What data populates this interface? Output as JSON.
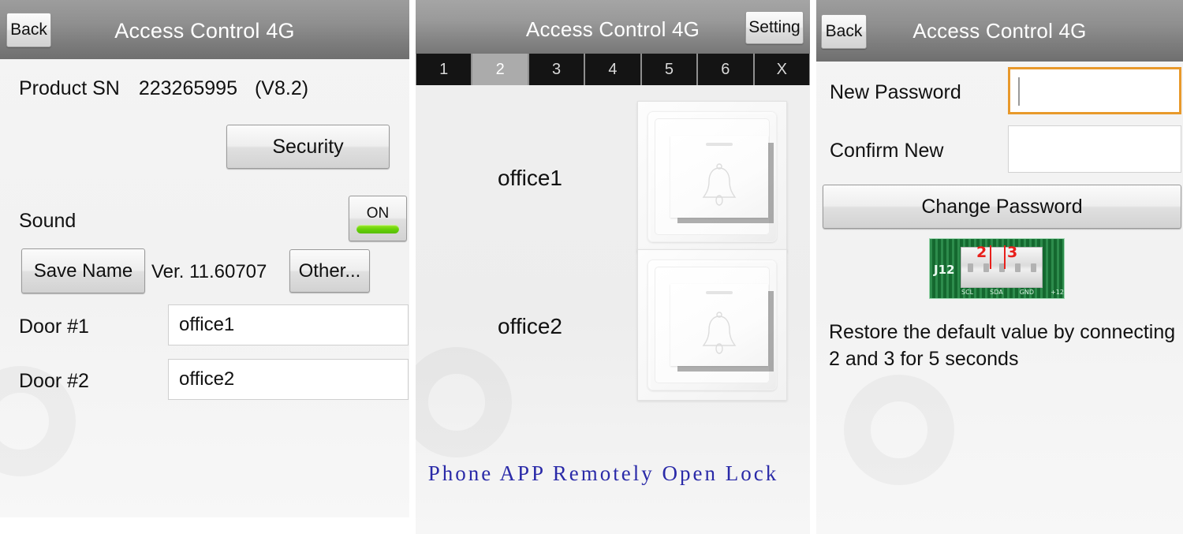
{
  "app": {
    "title": "Access Control 4G"
  },
  "panel1": {
    "header": {
      "title": "Access Control 4G",
      "back_label": "Back",
      "back_icon": "back-arrow-icon"
    },
    "product_sn": {
      "label": "Product SN",
      "value": "223265995",
      "version": "(V8.2)"
    },
    "security_button": "Security",
    "sound": {
      "label": "Sound",
      "toggle_state": "ON",
      "toggle_color": "#64cf08"
    },
    "save_name_button": "Save Name",
    "version_label": "Ver. 11.60707",
    "other_button": "Other...",
    "doors": [
      {
        "label": "Door #1",
        "value": "office1",
        "placeholder": "Door name"
      },
      {
        "label": "Door #2",
        "value": "office2",
        "placeholder": "Door name"
      }
    ]
  },
  "panel2": {
    "header": {
      "title": "Access Control 4G",
      "setting_label": "Setting"
    },
    "tabs": [
      {
        "label": "1",
        "selected": false
      },
      {
        "label": "2",
        "selected": true
      },
      {
        "label": "3",
        "selected": false
      },
      {
        "label": "4",
        "selected": false
      },
      {
        "label": "5",
        "selected": false
      },
      {
        "label": "6",
        "selected": false
      },
      {
        "label": "X",
        "selected": false
      }
    ],
    "switches": [
      {
        "name": "office1",
        "icon": "doorbell-switch-icon"
      },
      {
        "name": "office2",
        "icon": "doorbell-switch-icon"
      }
    ],
    "caption": "Phone APP Remotely Open Lock",
    "caption_color": "#2a2aa8"
  },
  "panel3": {
    "header": {
      "title": "Access Control 4G",
      "back_label": "Back"
    },
    "new_password": {
      "label": "New Password",
      "value": "",
      "placeholder": "",
      "focused": true
    },
    "confirm_password": {
      "label": "Confirm New",
      "value": "",
      "placeholder": "",
      "focused": false
    },
    "change_password_button": "Change Password",
    "focus_color": "#e8992b",
    "pcb": {
      "connector_label": "J12",
      "pin_markers": [
        "2",
        "3"
      ],
      "silkscreen": [
        "SCL",
        "SDA",
        "GND",
        "+12"
      ],
      "marker_color": "#e8201c",
      "board_color": "#1f7a3e"
    },
    "restore_text": "Restore the default value by connecting 2 and 3 for 5 seconds"
  }
}
